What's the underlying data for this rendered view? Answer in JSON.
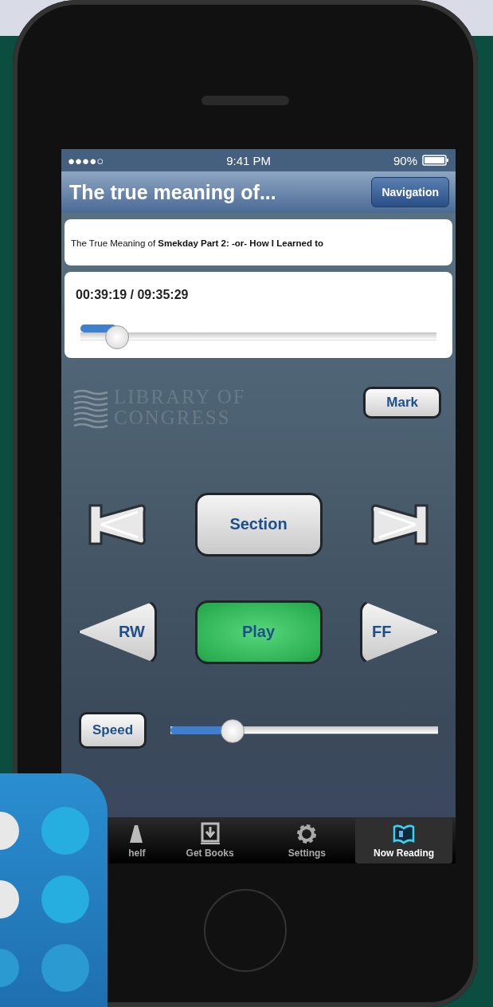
{
  "status_bar": {
    "signal": "●●●●○",
    "time": "9:41 PM",
    "battery": "90%"
  },
  "nav_bar": {
    "title": "The true meaning of...",
    "button": "Navigation"
  },
  "book_title": "The True Meaning of **Smekday Part 2: -or- How I Learned to**",
  "progress": {
    "time": "00:39:19 / 09:35:29",
    "level": 0.1
  },
  "logo": {
    "line_1": "LIBRARY OF",
    "line_2": "CONGRESS"
  },
  "mark_button": "Mark",
  "controls": [
    {
      "kind": "previous"
    },
    {
      "kind": "text",
      "label": "Section"
    },
    {
      "kind": "next"
    },
    {
      "kind": "rewind",
      "label": "RW"
    },
    {
      "kind": "play",
      "label": "Play"
    },
    {
      "kind": "forward",
      "label": "FF"
    }
  ],
  "speed": {
    "button": "Speed",
    "level": 0.23
  },
  "tabs": [
    {
      "label": "helf",
      "kind": "shelf",
      "selected": false
    },
    {
      "label": "Get Books",
      "kind": "download",
      "selected": false
    },
    {
      "label": "Settings",
      "kind": "settings",
      "selected": false
    },
    {
      "label": "Now Reading",
      "kind": "reading",
      "selected": true
    }
  ]
}
